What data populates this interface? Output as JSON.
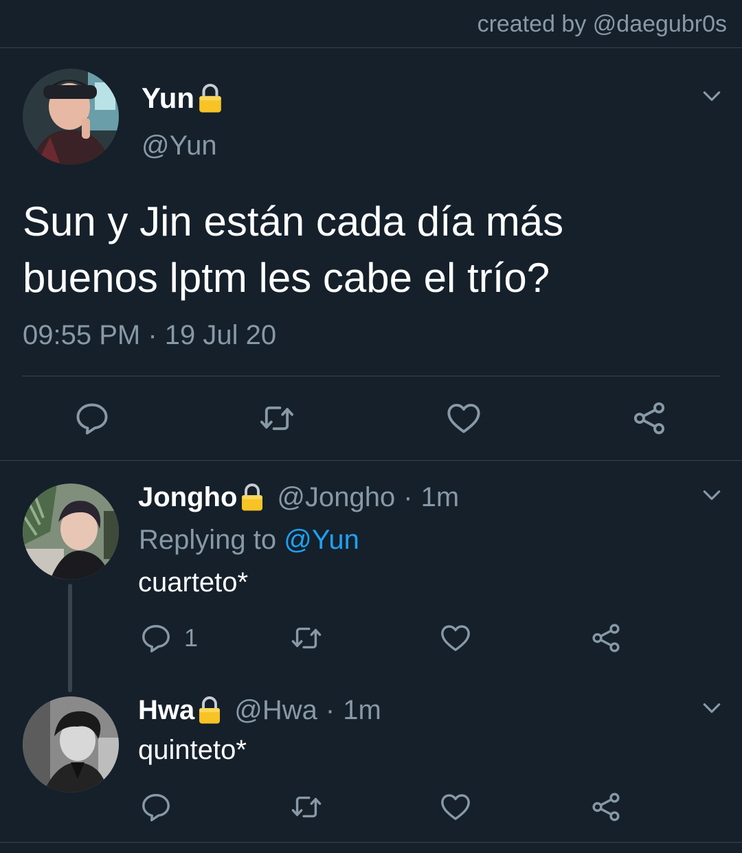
{
  "credit": "created by @daegubr0s",
  "main_tweet": {
    "name": "Yun",
    "handle": "@Yun",
    "text": "Sun y Jin están cada día más buenos lptm les cabe el trío?",
    "time": "09:55 PM",
    "separator": "·",
    "date": "19 Jul 20",
    "icons": [
      "lock-icon",
      "chevron-down-icon",
      "reply-icon",
      "retweet-icon",
      "like-icon",
      "share-icon"
    ]
  },
  "replies": [
    {
      "name": "Jongho",
      "handle": "@Jongho",
      "age": "1m",
      "replying_label": "Replying to",
      "replying_to": "@Yun",
      "text": "cuarteto*",
      "reply_count": "1"
    },
    {
      "name": "Hwa",
      "handle": "@Hwa",
      "age": "1m",
      "text": "quinteto*"
    }
  ],
  "colors": {
    "background": "#15202b",
    "text": "#ffffff",
    "muted": "#8899a6",
    "link": "#1da1f2",
    "divider": "#38444d",
    "lock": "#f7c325"
  }
}
